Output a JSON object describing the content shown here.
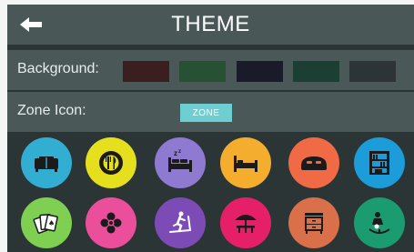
{
  "header": {
    "title": "THEME",
    "back_icon": "arrow-left-icon"
  },
  "background_row": {
    "label": "Background:",
    "swatches": [
      "#3b1f20",
      "#275133",
      "#191b2b",
      "#1b3f32",
      "#2c3437"
    ]
  },
  "zone_icon_row": {
    "label": "Zone Icon:",
    "chip_label": "ZONE",
    "chip_color": "#6ecfd3"
  },
  "icons": [
    {
      "name": "sofa-icon",
      "color": "#33aed3"
    },
    {
      "name": "dining-icon",
      "color": "#e6df1e"
    },
    {
      "name": "sleeping-bed-icon",
      "color": "#8e7bd1"
    },
    {
      "name": "single-bed-icon",
      "color": "#f5ad2e"
    },
    {
      "name": "double-bed-icon",
      "color": "#f06a45"
    },
    {
      "name": "bookshelf-icon",
      "color": "#1c9cd8"
    },
    {
      "name": "playing-cards-icon",
      "color": "#7fcf53"
    },
    {
      "name": "flower-icon",
      "color": "#eb4f9c"
    },
    {
      "name": "treadmill-icon",
      "color": "#7d4bb6"
    },
    {
      "name": "patio-umbrella-icon",
      "color": "#e62068"
    },
    {
      "name": "cabinet-icon",
      "color": "#d9704a"
    },
    {
      "name": "baby-changing-icon",
      "color": "#1a9b70"
    }
  ]
}
